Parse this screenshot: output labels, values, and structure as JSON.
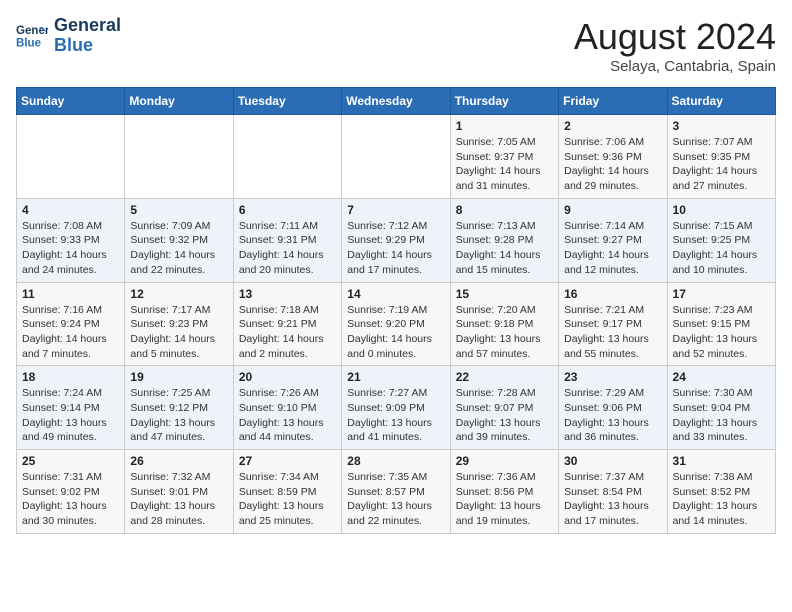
{
  "header": {
    "logo_line1": "General",
    "logo_line2": "Blue",
    "month_title": "August 2024",
    "location": "Selaya, Cantabria, Spain"
  },
  "weekdays": [
    "Sunday",
    "Monday",
    "Tuesday",
    "Wednesday",
    "Thursday",
    "Friday",
    "Saturday"
  ],
  "weeks": [
    [
      {
        "day": "",
        "info": ""
      },
      {
        "day": "",
        "info": ""
      },
      {
        "day": "",
        "info": ""
      },
      {
        "day": "",
        "info": ""
      },
      {
        "day": "1",
        "info": "Sunrise: 7:05 AM\nSunset: 9:37 PM\nDaylight: 14 hours\nand 31 minutes."
      },
      {
        "day": "2",
        "info": "Sunrise: 7:06 AM\nSunset: 9:36 PM\nDaylight: 14 hours\nand 29 minutes."
      },
      {
        "day": "3",
        "info": "Sunrise: 7:07 AM\nSunset: 9:35 PM\nDaylight: 14 hours\nand 27 minutes."
      }
    ],
    [
      {
        "day": "4",
        "info": "Sunrise: 7:08 AM\nSunset: 9:33 PM\nDaylight: 14 hours\nand 24 minutes."
      },
      {
        "day": "5",
        "info": "Sunrise: 7:09 AM\nSunset: 9:32 PM\nDaylight: 14 hours\nand 22 minutes."
      },
      {
        "day": "6",
        "info": "Sunrise: 7:11 AM\nSunset: 9:31 PM\nDaylight: 14 hours\nand 20 minutes."
      },
      {
        "day": "7",
        "info": "Sunrise: 7:12 AM\nSunset: 9:29 PM\nDaylight: 14 hours\nand 17 minutes."
      },
      {
        "day": "8",
        "info": "Sunrise: 7:13 AM\nSunset: 9:28 PM\nDaylight: 14 hours\nand 15 minutes."
      },
      {
        "day": "9",
        "info": "Sunrise: 7:14 AM\nSunset: 9:27 PM\nDaylight: 14 hours\nand 12 minutes."
      },
      {
        "day": "10",
        "info": "Sunrise: 7:15 AM\nSunset: 9:25 PM\nDaylight: 14 hours\nand 10 minutes."
      }
    ],
    [
      {
        "day": "11",
        "info": "Sunrise: 7:16 AM\nSunset: 9:24 PM\nDaylight: 14 hours\nand 7 minutes."
      },
      {
        "day": "12",
        "info": "Sunrise: 7:17 AM\nSunset: 9:23 PM\nDaylight: 14 hours\nand 5 minutes."
      },
      {
        "day": "13",
        "info": "Sunrise: 7:18 AM\nSunset: 9:21 PM\nDaylight: 14 hours\nand 2 minutes."
      },
      {
        "day": "14",
        "info": "Sunrise: 7:19 AM\nSunset: 9:20 PM\nDaylight: 14 hours\nand 0 minutes."
      },
      {
        "day": "15",
        "info": "Sunrise: 7:20 AM\nSunset: 9:18 PM\nDaylight: 13 hours\nand 57 minutes."
      },
      {
        "day": "16",
        "info": "Sunrise: 7:21 AM\nSunset: 9:17 PM\nDaylight: 13 hours\nand 55 minutes."
      },
      {
        "day": "17",
        "info": "Sunrise: 7:23 AM\nSunset: 9:15 PM\nDaylight: 13 hours\nand 52 minutes."
      }
    ],
    [
      {
        "day": "18",
        "info": "Sunrise: 7:24 AM\nSunset: 9:14 PM\nDaylight: 13 hours\nand 49 minutes."
      },
      {
        "day": "19",
        "info": "Sunrise: 7:25 AM\nSunset: 9:12 PM\nDaylight: 13 hours\nand 47 minutes."
      },
      {
        "day": "20",
        "info": "Sunrise: 7:26 AM\nSunset: 9:10 PM\nDaylight: 13 hours\nand 44 minutes."
      },
      {
        "day": "21",
        "info": "Sunrise: 7:27 AM\nSunset: 9:09 PM\nDaylight: 13 hours\nand 41 minutes."
      },
      {
        "day": "22",
        "info": "Sunrise: 7:28 AM\nSunset: 9:07 PM\nDaylight: 13 hours\nand 39 minutes."
      },
      {
        "day": "23",
        "info": "Sunrise: 7:29 AM\nSunset: 9:06 PM\nDaylight: 13 hours\nand 36 minutes."
      },
      {
        "day": "24",
        "info": "Sunrise: 7:30 AM\nSunset: 9:04 PM\nDaylight: 13 hours\nand 33 minutes."
      }
    ],
    [
      {
        "day": "25",
        "info": "Sunrise: 7:31 AM\nSunset: 9:02 PM\nDaylight: 13 hours\nand 30 minutes."
      },
      {
        "day": "26",
        "info": "Sunrise: 7:32 AM\nSunset: 9:01 PM\nDaylight: 13 hours\nand 28 minutes."
      },
      {
        "day": "27",
        "info": "Sunrise: 7:34 AM\nSunset: 8:59 PM\nDaylight: 13 hours\nand 25 minutes."
      },
      {
        "day": "28",
        "info": "Sunrise: 7:35 AM\nSunset: 8:57 PM\nDaylight: 13 hours\nand 22 minutes."
      },
      {
        "day": "29",
        "info": "Sunrise: 7:36 AM\nSunset: 8:56 PM\nDaylight: 13 hours\nand 19 minutes."
      },
      {
        "day": "30",
        "info": "Sunrise: 7:37 AM\nSunset: 8:54 PM\nDaylight: 13 hours\nand 17 minutes."
      },
      {
        "day": "31",
        "info": "Sunrise: 7:38 AM\nSunset: 8:52 PM\nDaylight: 13 hours\nand 14 minutes."
      }
    ]
  ]
}
